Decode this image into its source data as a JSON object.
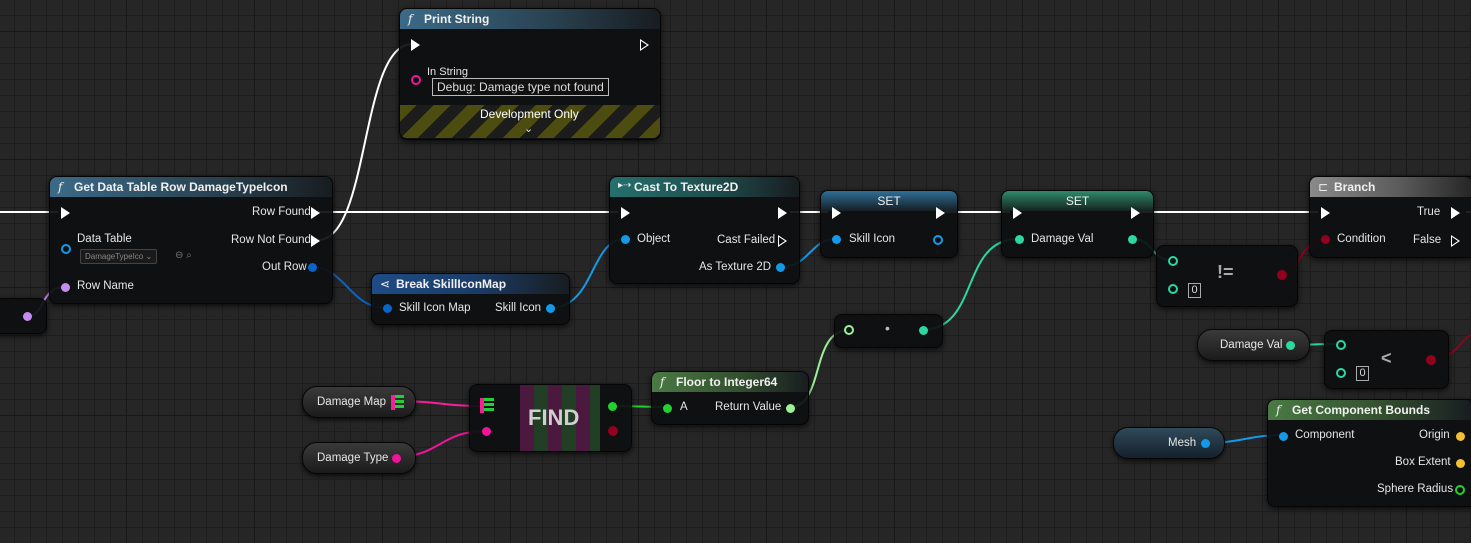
{
  "colors": {
    "exec": "#ffffff",
    "object": "#1399e8",
    "struct": "#0a63c9",
    "name": "#c58bf1",
    "string": "#f0139c",
    "bool": "#93001d",
    "int": "#2ad8a0",
    "float": "#9cf09a",
    "map": "#f71e9c",
    "find": "#20d12f",
    "vector": "#f4bf30"
  },
  "print_string": {
    "title": "Print String",
    "in_string_label": "In String",
    "in_string_value": "Debug: Damage type not found",
    "dev_only": "Development Only",
    "expand_icon": "chevron-down-icon"
  },
  "get_row": {
    "title": "Get Data Table Row DamageTypeIcon",
    "data_table_label": "Data Table",
    "data_table_value": "DamageTypeIco",
    "row_name_label": "Row Name",
    "row_found": "Row Found",
    "row_not_found": "Row Not Found",
    "out_row": "Out Row"
  },
  "break_node": {
    "title": "Break SkillIconMap",
    "in_label": "Skill Icon Map",
    "out_label": "Skill Icon"
  },
  "cast": {
    "title": "Cast To Texture2D",
    "object_label": "Object",
    "cast_failed": "Cast Failed",
    "as_texture": "As Texture 2D"
  },
  "set1": {
    "title": "SET",
    "label": "Skill Icon"
  },
  "set2": {
    "title": "SET",
    "label": "Damage Val"
  },
  "branch": {
    "title": "Branch",
    "condition": "Condition",
    "true_label": "True",
    "false_label": "False"
  },
  "not_equal": {
    "op": "!=",
    "value": "0"
  },
  "less": {
    "op": "<",
    "value": "0"
  },
  "multiply": {
    "op": "•"
  },
  "floor": {
    "title": "Floor to Integer64",
    "a": "A",
    "ret": "Return Value"
  },
  "find": {
    "label": "FIND"
  },
  "get_bounds": {
    "title": "Get Component Bounds",
    "component": "Component",
    "origin": "Origin",
    "box_extent": "Box Extent",
    "sphere_radius": "Sphere Radius"
  },
  "vars": {
    "damage_map": "Damage Map",
    "damage_type": "Damage Type",
    "damage_val": "Damage Val",
    "mesh": "Mesh"
  }
}
